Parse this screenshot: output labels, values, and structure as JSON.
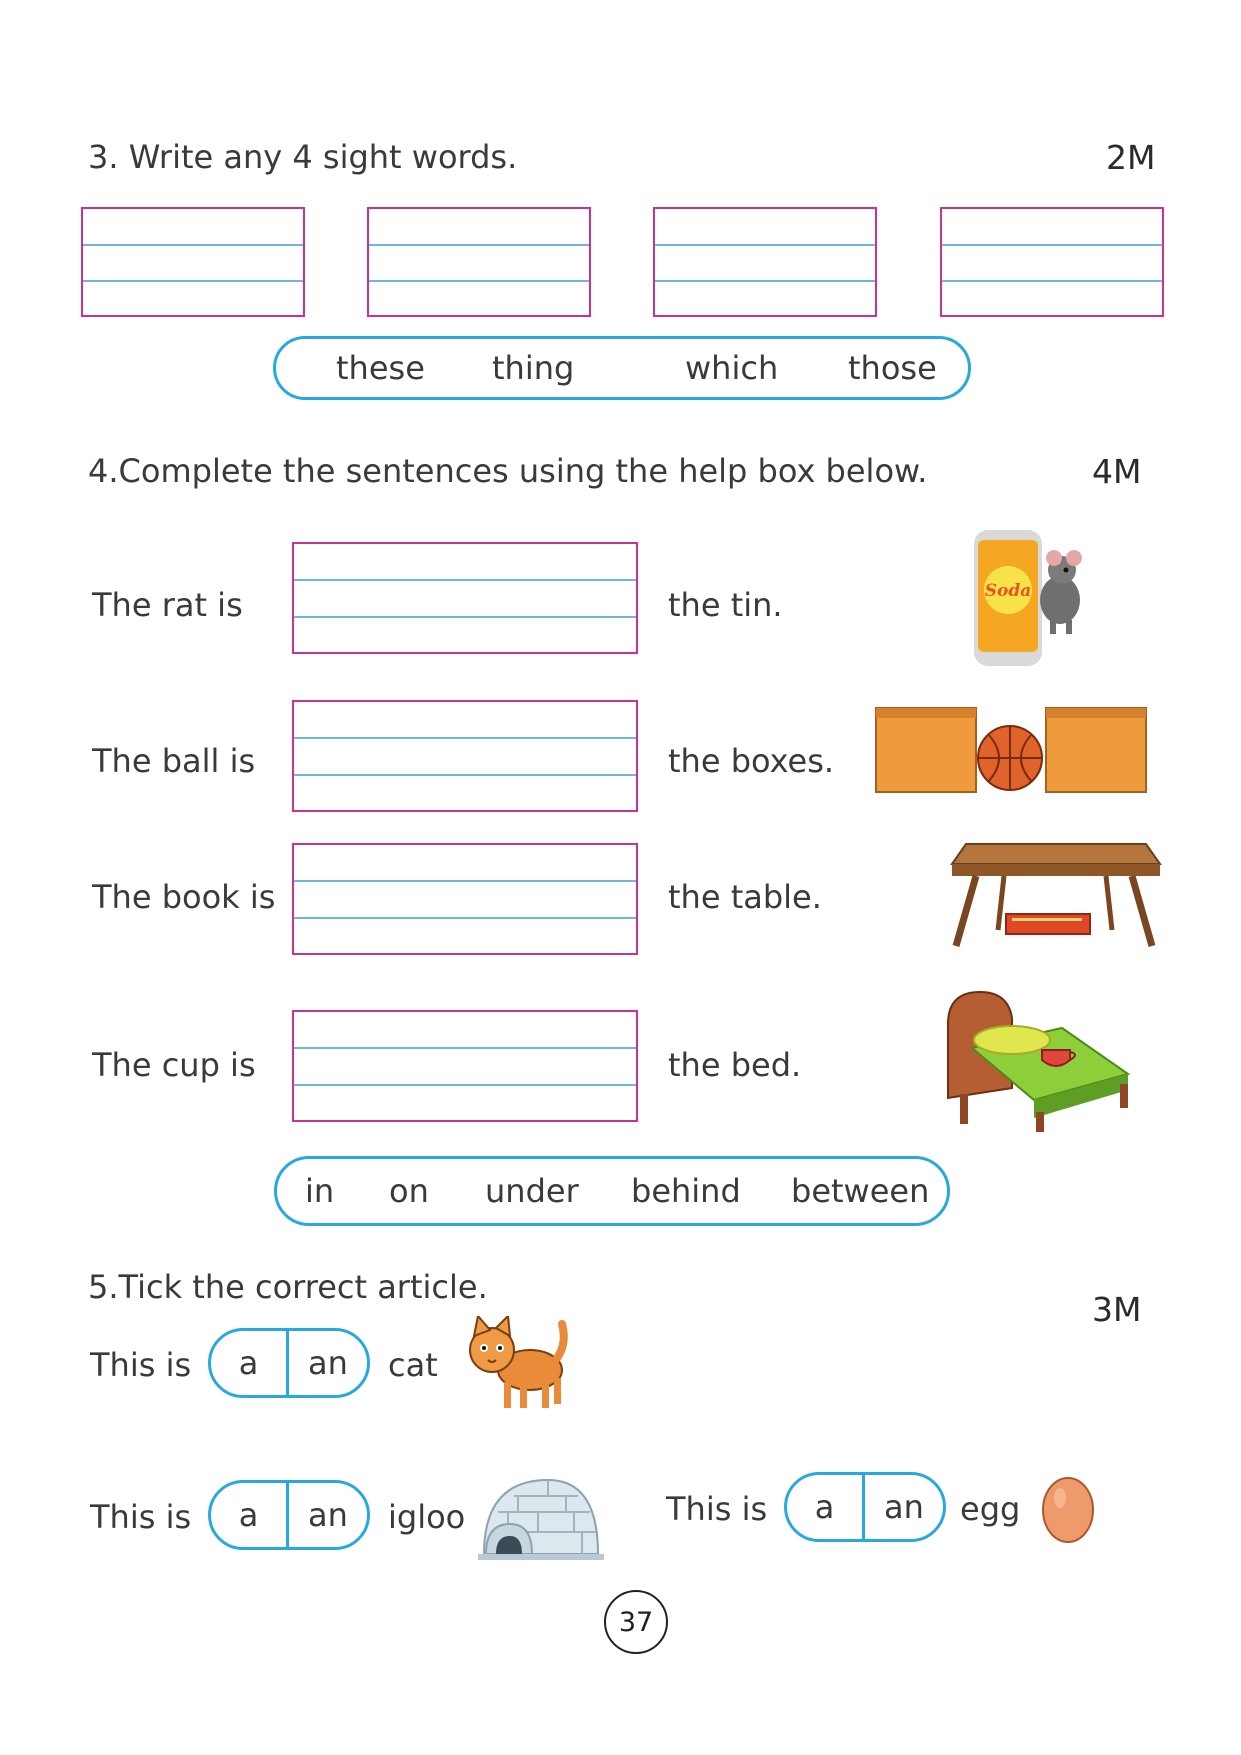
{
  "q3": {
    "title": "3. Write any 4 sight words.",
    "marks": "2M",
    "help_words": [
      "these",
      "thing",
      "which",
      "those"
    ]
  },
  "q4": {
    "title": "4.Complete the sentences using the help box below.",
    "marks": "4M",
    "rows": [
      {
        "subject": "The rat is",
        "object": "the tin.",
        "picture": "soda-can-rat-picture",
        "can_label": "Soda"
      },
      {
        "subject": "The ball is",
        "object": "the boxes.",
        "picture": "ball-between-boxes-picture"
      },
      {
        "subject": "The book is",
        "object": "the table.",
        "picture": "book-under-table-picture"
      },
      {
        "subject": "The cup is",
        "object": "the bed.",
        "picture": "cup-on-bed-picture"
      }
    ],
    "help_words": [
      "in",
      "on",
      "under",
      "behind",
      "between"
    ]
  },
  "q5": {
    "title": "5.Tick the correct article.",
    "marks": "3M",
    "items": [
      {
        "prefix": "This is",
        "option_a": "a",
        "option_b": "an",
        "noun": "cat",
        "picture": "cat-picture"
      },
      {
        "prefix": "This is",
        "option_a": "a",
        "option_b": "an",
        "noun": "igloo",
        "picture": "igloo-picture"
      },
      {
        "prefix": "This is",
        "option_a": "a",
        "option_b": "an",
        "noun": "egg",
        "picture": "egg-picture"
      }
    ]
  },
  "page_number": "37",
  "colors": {
    "box_border": "#c8338e",
    "ruled_line": "#6fb6d9",
    "pill_border": "#29a8de"
  }
}
